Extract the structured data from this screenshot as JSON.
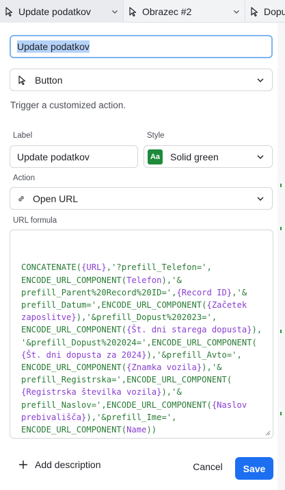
{
  "tabs": [
    {
      "label": "Update podatkov"
    },
    {
      "label": "Obrazec #2"
    },
    {
      "label": "Dopu"
    }
  ],
  "name_field": {
    "value": "Update podatkov"
  },
  "element_type": {
    "label": "Button"
  },
  "description": "Trigger a customized action.",
  "label_field": {
    "label": "Label",
    "value": "Update podatkov"
  },
  "style_field": {
    "label": "Style",
    "swatch": "Aa",
    "value": "Solid green",
    "color": "#1e8a3c"
  },
  "action_field": {
    "label": "Action",
    "value": "Open URL"
  },
  "url_formula": {
    "label": "URL formula",
    "lines": [
      "CONCATENATE({URL},'?prefill_Telefon=',",
      "ENCODE_URL_COMPONENT(Telefon),'&",
      "prefill_Parent%20Record%20ID=',{Record ID},'&",
      "prefill_Datum=',ENCODE_URL_COMPONENT({Začetek",
      "zaposlitve}),'&prefill_Dopust%202023=',",
      "ENCODE_URL_COMPONENT({Št. dni starega dopusta}),",
      "'&prefill_Dopust%202024=',ENCODE_URL_COMPONENT(",
      "{Št. dni dopusta za 2024}),'&prefill_Avto=',",
      "ENCODE_URL_COMPONENT({Znamka vozila}),'&",
      "prefill_Registrska=',ENCODE_URL_COMPONENT(",
      "{Registrska številka vozila}),'&",
      "prefill_Naslov=',ENCODE_URL_COMPONENT({Naslov",
      "prebivališča}),'&prefill_Ime=',",
      "ENCODE_URL_COMPONENT(Name))"
    ]
  },
  "footer": {
    "add_description": "Add description",
    "cancel": "Cancel",
    "save": "Save"
  },
  "colors": {
    "accent": "#1d6ff2",
    "focus": "#7fb3f0",
    "formula_text": "#1e7a3c"
  }
}
